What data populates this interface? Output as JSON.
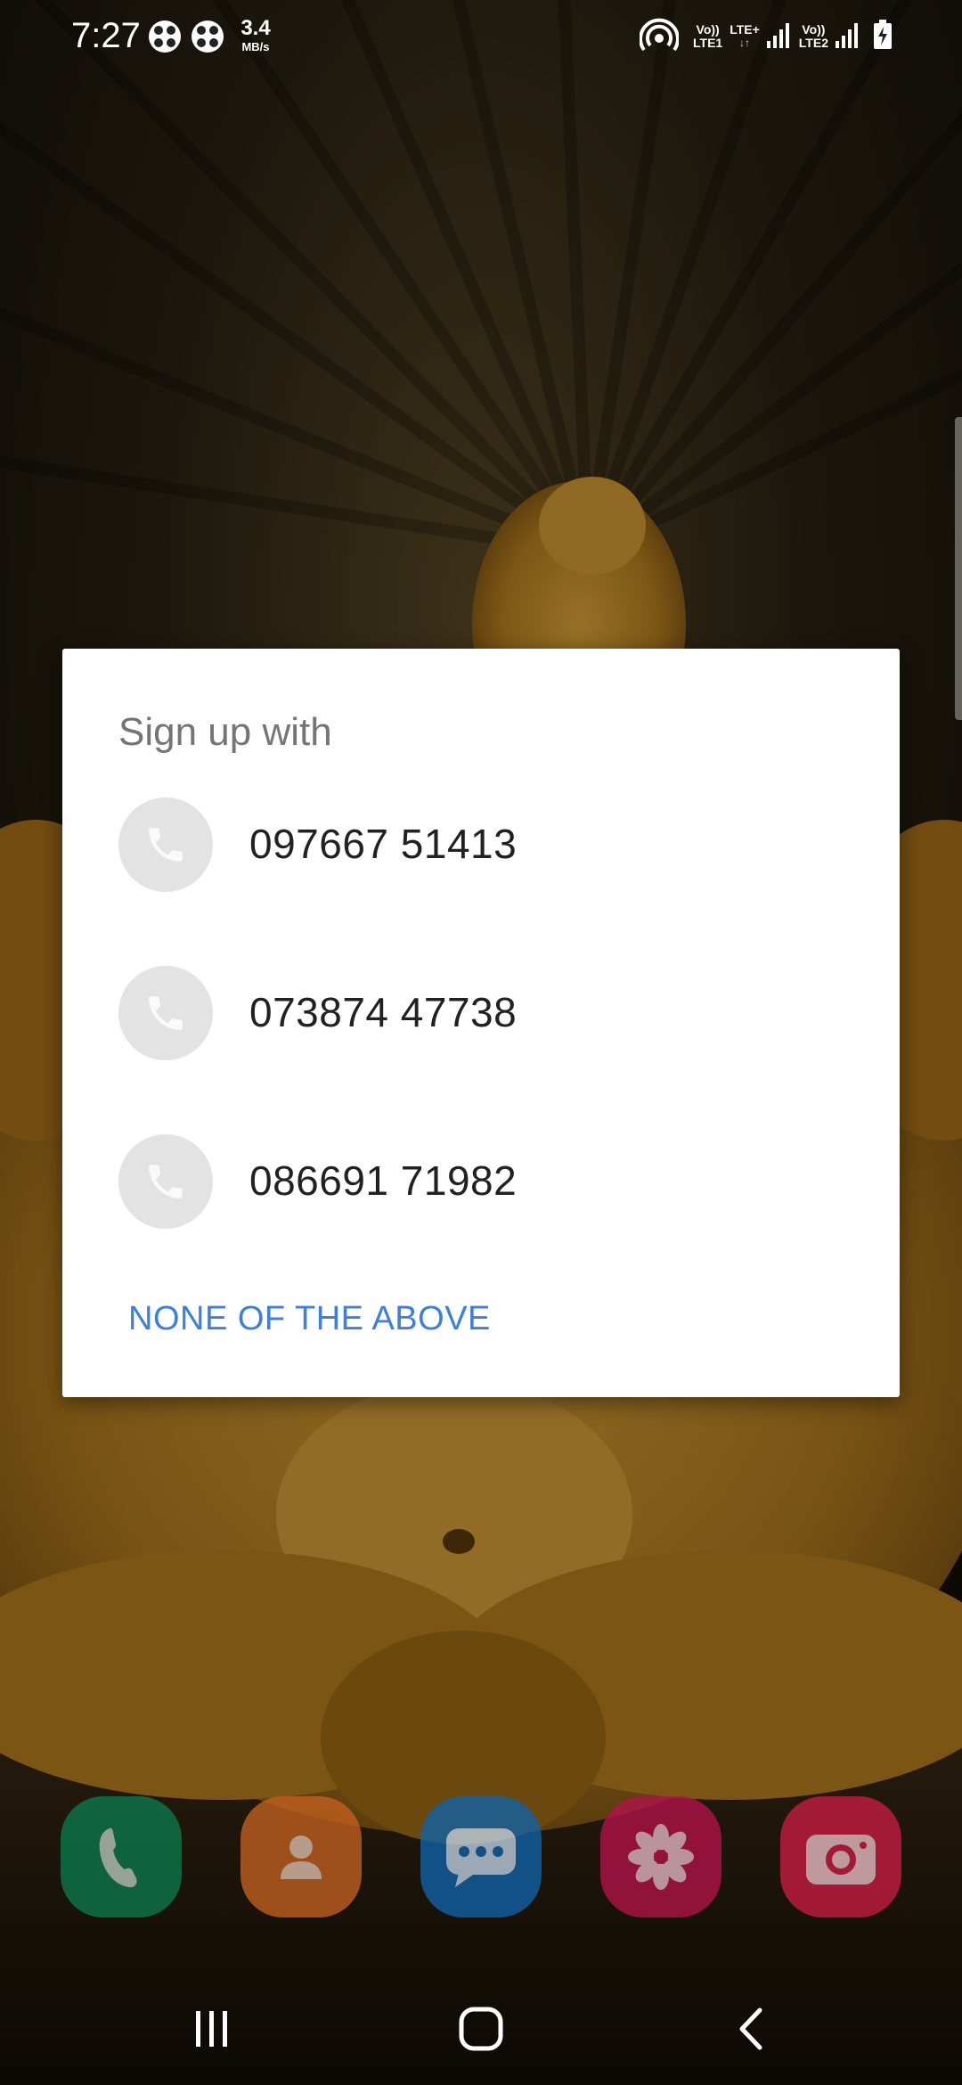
{
  "status_bar": {
    "time": "7:27",
    "notification_icons": [
      "grid-app-icon",
      "grid-app-icon"
    ],
    "network_speed_value": "3.4",
    "network_speed_unit": "MB/s",
    "sim1_top": "Vo))",
    "sim1_type": "LTE+",
    "sim1_label": "LTE1",
    "sim2_top": "Vo))",
    "sim2_label": "LTE2",
    "icons": [
      "hotspot-icon",
      "signal-icon",
      "signal-icon",
      "battery-charging-icon"
    ]
  },
  "dialog": {
    "title": "Sign up with",
    "accounts": [
      {
        "number": "097667 51413",
        "icon": "phone-icon"
      },
      {
        "number": "073874 47738",
        "icon": "phone-icon"
      },
      {
        "number": "086691 71982",
        "icon": "phone-icon"
      }
    ],
    "none_label": "NONE OF THE ABOVE"
  },
  "dock": {
    "apps": [
      {
        "name": "phone-app-icon",
        "color": "#0b7a4e"
      },
      {
        "name": "contacts-app-icon",
        "color": "#c4601f"
      },
      {
        "name": "messages-app-icon",
        "color": "#0f63a8"
      },
      {
        "name": "gallery-app-icon",
        "color": "#b3124a"
      },
      {
        "name": "camera-app-icon",
        "color": "#c81c40"
      }
    ]
  },
  "colors": {
    "accent": "#3c7fe0",
    "dialog_bg": "#ffffff",
    "title_text": "#757575",
    "number_text": "#212121",
    "avatar_bg": "#e3e3e3"
  }
}
